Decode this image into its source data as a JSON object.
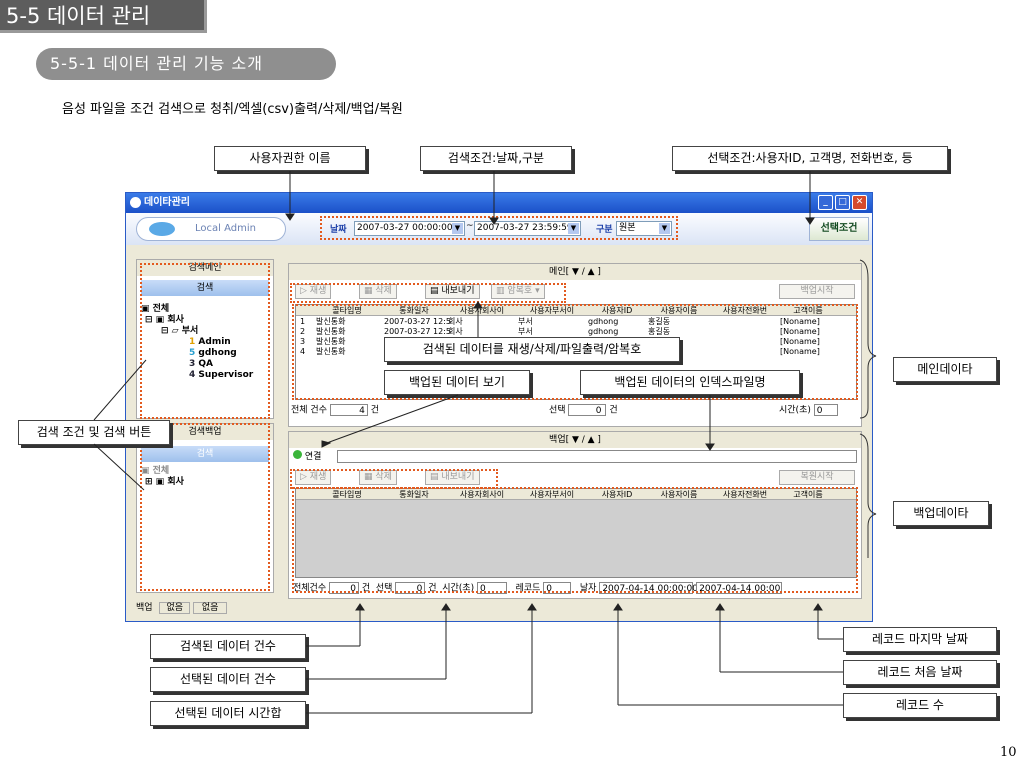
{
  "section_title": "5-5 데이터 관리",
  "subsection_title": "5-5-1 데이터 관리 기능 소개",
  "description": "음성 파일을 조건 검색으로 청취/엑셀(csv)출력/삭제/백업/복원",
  "callouts": {
    "user_auth": "사용자권한 이름",
    "search_cond": "검색조건:날짜,구분",
    "select_cond": "선택조건:사용자ID, 고객명, 전화번호, 등",
    "search_btns": "검색 조건 및 검색 버튼",
    "main_data": "메인데이타",
    "backup_data": "백업데이타",
    "play_delete": "검색된 데이터를 재생/삭제/파일출력/암복호",
    "view_backup": "백업된 데이터 보기",
    "backup_index": "백업된 데이터의 인덱스파일명",
    "searched_count": "검색된 데이터 건수",
    "selected_count": "선택된 데이터 건수",
    "selected_time": "선택된 데이터 시간합",
    "record_count": "레코드 수",
    "record_first": "레코드 처음 날짜",
    "record_last": "레코드 마지막 날짜"
  },
  "window": {
    "title": "데이타관리",
    "user": "Local Admin",
    "date_label": "날짜",
    "date_from": "2007-03-27 00:00:00",
    "tilde": "~",
    "date_to": "2007-03-27 23:59:59",
    "type_label": "구분",
    "type_value": "원본",
    "select_button": "선택조건",
    "left_top_header": "검색메인",
    "left_top_button": "검색",
    "tree_main": [
      "전체",
      "회사",
      "부서",
      "Admin",
      "gdhong",
      "QA",
      "Supervisor"
    ],
    "tree_nums": [
      "1",
      "5",
      "3",
      "4"
    ],
    "left_bottom_header": "검색백업",
    "left_bottom_button": "검색",
    "tree_backup": [
      "전체",
      "회사"
    ],
    "status_backup": "백업",
    "status_v1": "없음",
    "status_v2": "없음",
    "main_header": "메인[ ▼ / ▲ ]",
    "main_tools": [
      "재생",
      "삭제",
      "내보내기",
      "암복호"
    ],
    "main_right_btn": "백업시작",
    "columns": [
      "콜타입명",
      "통화일자",
      "사용자회사이",
      "사용자부서이",
      "사용자ID",
      "사용자이름",
      "사용자전화번",
      "고객이름"
    ],
    "rows": [
      [
        "1",
        "발신통화",
        "2007-03-27 12:5",
        "회사",
        "부서",
        "gdhong",
        "홍길동",
        "",
        "[Noname]"
      ],
      [
        "2",
        "발신통화",
        "2007-03-27 12:5",
        "회사",
        "부서",
        "gdhong",
        "홍길동",
        "",
        "[Noname]"
      ],
      [
        "3",
        "발신통화",
        "",
        "",
        "",
        "",
        "",
        "",
        "[Noname]"
      ],
      [
        "4",
        "발신통화",
        "",
        "",
        "",
        "",
        "",
        "",
        "[Noname]"
      ]
    ],
    "main_total_label": "전체 건수",
    "main_total": "4",
    "unit": "건",
    "main_sel_label": "선택",
    "main_sel": "0",
    "main_time_label": "시간(초)",
    "main_time": "0",
    "backup_header": "백업[ ▼ / ▲ ]",
    "conn_label": "연결",
    "backup_tools": [
      "재생",
      "삭제",
      "내보내기"
    ],
    "backup_right_btn": "복원시작",
    "b_total_label": "전체건수",
    "b_total": "0",
    "b_sel_label": "선택",
    "b_sel": "0",
    "b_time_label": "시간(초)",
    "b_time": "0",
    "b_rec_label": "레코드",
    "b_rec": "0",
    "b_date_label": "날자",
    "b_date_from": "2007-04-14 00:00:00",
    "b_date_to": "2007-04-14 00:00:00"
  },
  "page_number": "10"
}
